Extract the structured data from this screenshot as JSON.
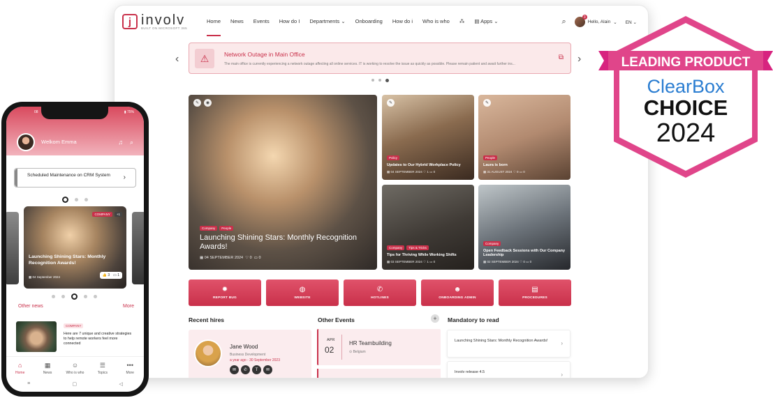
{
  "tablet": {
    "logo": {
      "brand": "involv",
      "sub": "BUILT ON MICROSOFT 365"
    },
    "nav": [
      "Home",
      "News",
      "Events",
      "How do I",
      "Departments",
      "Onboarding",
      "How do i",
      "Who is who",
      "Apps"
    ],
    "nav_active": "Home",
    "user_greeting": "Hello, Alain",
    "notification_count": "3",
    "language": "EN",
    "alert": {
      "title": "Network Outage in Main Office",
      "text": "The main office is currently experiencing a network outage affecting all online services. IT is working to resolve the issue as quickly as possible. Please remain patient and await further ins..."
    },
    "main_story": {
      "tags": [
        "Company",
        "People"
      ],
      "title": "Launching Shining Stars: Monthly Recognition Awards!",
      "date": "04 SEPTEMBER 2024",
      "likes": "0",
      "comments": "0"
    },
    "stories": [
      {
        "tags": [
          "Policy"
        ],
        "title": "Updates to Our Hybrid Workplace Policy",
        "date": "04 SEPTEMBER 2024",
        "likes": "1",
        "comments": "0"
      },
      {
        "tags": [
          "People"
        ],
        "title": "Laura is born",
        "date": "31 AUGUST 2024",
        "likes": "0",
        "comments": "0"
      },
      {
        "tags": [
          "Company",
          "Tips & Tricks"
        ],
        "title": "Tips for Thriving While Working Shifts",
        "date": "03 SEPTEMBER 2024",
        "likes": "1",
        "comments": "0"
      },
      {
        "tags": [
          "Company"
        ],
        "title": "Open Feedback Sessions with Our Company Leadership",
        "date": "02 SEPTEMBER 2024",
        "likes": "0",
        "comments": "0"
      }
    ],
    "quick_links": [
      {
        "label": "REPORT BUG",
        "icon": "bug-icon",
        "glyph": "✹"
      },
      {
        "label": "WEBSITE",
        "icon": "globe-icon",
        "glyph": "◍"
      },
      {
        "label": "HOTLINES",
        "icon": "phone-icon",
        "glyph": "✆"
      },
      {
        "label": "ONBOARDING ADMIN",
        "icon": "users-icon",
        "glyph": "☻"
      },
      {
        "label": "PROCEDURES",
        "icon": "document-icon",
        "glyph": "▤"
      }
    ],
    "recent_hires": {
      "title": "Recent hires",
      "name": "Jane Wood",
      "role": "Business Development",
      "date": "a year ago - 30 September 2023"
    },
    "other_events": {
      "title": "Other Events",
      "month": "APR",
      "day": "02",
      "event_title": "HR Teambuilding",
      "location": "Belgium"
    },
    "mandatory": {
      "title": "Mandatory to read",
      "items": [
        "Launching Shining Stars: Monthly Recognition Awards!",
        "Involv release 4.5"
      ]
    }
  },
  "badge": {
    "line1": "LEADING PRODUCT",
    "line2": "ClearBox",
    "line3": "CHOICE",
    "line4": "2024"
  },
  "phone": {
    "time": "08",
    "battery": "75%",
    "welcome": "Welkom Emma",
    "maintenance": "Scheduled Maintenance on CRM System",
    "card": {
      "tag": "COMPANY",
      "extra": "+1",
      "title": "Launching Shining Stars: Monthly Recognition Awards!",
      "date": "04 September 2024",
      "likes": "3",
      "comments": "1"
    },
    "other_news": "Other news",
    "more": "More",
    "news_tag": "COMPANY",
    "news_title": "Here are 7 unique and creative strategies to help remote workers feel more connected",
    "tabs": [
      {
        "label": "Home",
        "glyph": "⌂"
      },
      {
        "label": "News",
        "glyph": "▦"
      },
      {
        "label": "Who is who",
        "glyph": "☺"
      },
      {
        "label": "Topics",
        "glyph": "☰"
      },
      {
        "label": "More",
        "glyph": "•••"
      }
    ]
  }
}
